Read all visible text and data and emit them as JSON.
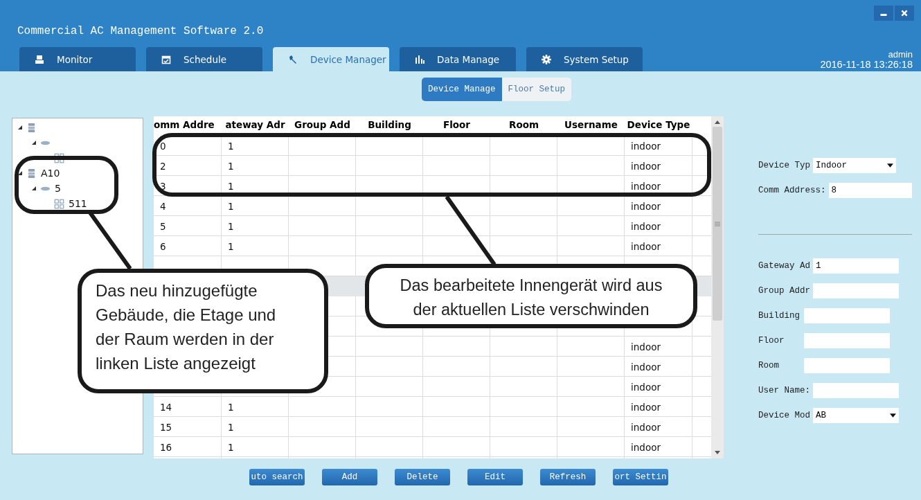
{
  "window": {
    "title": "Commercial AC Management Software 2.0"
  },
  "tabs": [
    {
      "label": "Monitor",
      "selected": false
    },
    {
      "label": "Schedule",
      "selected": false
    },
    {
      "label": "Device Manager",
      "selected": true
    },
    {
      "label": "Data Manage",
      "selected": false
    },
    {
      "label": "System Setup",
      "selected": false
    }
  ],
  "user": {
    "name": "admin",
    "datetime": "2016-11-18 13:26:18"
  },
  "subtabs": [
    {
      "label": "Device Manage",
      "selected": true
    },
    {
      "label": "Floor Setup",
      "selected": false
    }
  ],
  "tree": [
    {
      "kind": "building",
      "expanded": true,
      "children": [
        {
          "kind": "floor",
          "expanded": true,
          "children": [
            {
              "kind": "room"
            }
          ]
        }
      ]
    },
    {
      "kind": "building",
      "label": "A10",
      "expanded": true,
      "children": [
        {
          "kind": "floor",
          "label": "5",
          "expanded": true,
          "children": [
            {
              "kind": "room",
              "label": "511"
            }
          ]
        }
      ]
    }
  ],
  "table": {
    "columns": [
      "omm Addre",
      "ateway Adr",
      "Group Add",
      "Building",
      "Floor",
      "Room",
      "Username",
      "Device Type"
    ],
    "rows": [
      {
        "selected": false,
        "comm_address": "0",
        "gateway_address": "1",
        "device_type": "indoor"
      },
      {
        "selected": false,
        "comm_address": "2",
        "gateway_address": "1",
        "device_type": "indoor"
      },
      {
        "selected": false,
        "comm_address": "3",
        "gateway_address": "1",
        "device_type": "indoor"
      },
      {
        "selected": false,
        "comm_address": "4",
        "gateway_address": "1",
        "device_type": "indoor"
      },
      {
        "selected": false,
        "comm_address": "5",
        "gateway_address": "1",
        "device_type": "indoor"
      },
      {
        "selected": false,
        "comm_address": "6",
        "gateway_address": "1",
        "device_type": "indoor"
      },
      {
        "selected": false
      },
      {
        "selected": true
      },
      {
        "selected": false
      },
      {
        "selected": false
      },
      {
        "selected": false,
        "device_type": "indoor"
      },
      {
        "selected": false,
        "device_type": "indoor"
      },
      {
        "selected": false,
        "device_type": "indoor"
      },
      {
        "selected": false,
        "comm_address": "14",
        "gateway_address": "1",
        "device_type": "indoor"
      },
      {
        "selected": false,
        "comm_address": "15",
        "gateway_address": "1",
        "device_type": "indoor"
      },
      {
        "selected": false,
        "comm_address": "16",
        "gateway_address": "1",
        "device_type": "indoor"
      }
    ]
  },
  "form": {
    "top": [
      {
        "label": "Device Typ",
        "kind": "select",
        "value": "Indoor"
      },
      {
        "label": "Comm Address:",
        "kind": "text",
        "value": "8"
      }
    ],
    "bottom": [
      {
        "label": "Gateway Ad",
        "kind": "text",
        "value": "1"
      },
      {
        "label": "Group Addr",
        "kind": "text"
      },
      {
        "label": "Building",
        "kind": "text"
      },
      {
        "label": "Floor",
        "kind": "text"
      },
      {
        "label": "Room",
        "kind": "text"
      },
      {
        "label": "User Name:",
        "kind": "text"
      },
      {
        "label": "Device Mod",
        "kind": "select",
        "value": "AB"
      }
    ]
  },
  "buttons": [
    "uto search",
    "Add",
    "Delete",
    "Edit",
    "Refresh",
    "ort Settin"
  ],
  "callouts": [
    "Das neu hinzugefügte Gebäude, die Etage und der Raum werden in der linken Liste angezeigt",
    "Das bearbeitete Innengerät wird aus der aktuellen Liste verschwinden"
  ]
}
